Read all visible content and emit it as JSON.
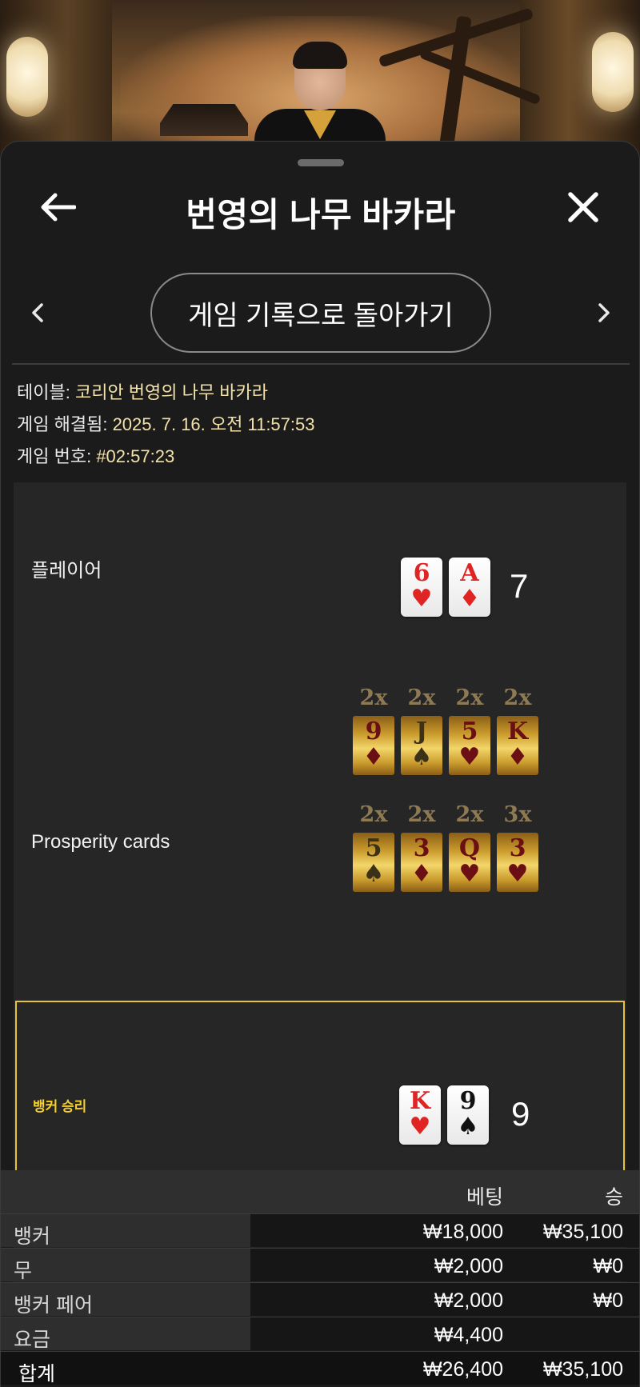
{
  "header": {
    "title": "번영의 나무 바카라",
    "back_icon": "arrow-left-icon",
    "close_icon": "close-icon"
  },
  "nav": {
    "back_to_history_label": "게임 기록으로 돌아가기",
    "prev_icon": "chevron-left-icon",
    "next_icon": "chevron-right-icon"
  },
  "info": {
    "table_label": "테이블:",
    "table_value": "코리안 번영의 나무 바카라",
    "resolved_label": "게임 해결됨:",
    "resolved_value": "2025. 7. 16. 오전 11:57:53",
    "game_no_label": "게임 번호:",
    "game_no_value": "#02:57:23"
  },
  "player": {
    "label": "플레이어",
    "cards": [
      {
        "rank": "6",
        "suit": "♥",
        "color": "red"
      },
      {
        "rank": "A",
        "suit": "♦",
        "color": "red"
      }
    ],
    "score": "7"
  },
  "prosperity": {
    "label": "Prosperity cards",
    "row1": [
      {
        "mult": "2x",
        "rank": "9",
        "suit": "♦",
        "tone": "red"
      },
      {
        "mult": "2x",
        "rank": "J",
        "suit": "♠",
        "tone": "dark"
      },
      {
        "mult": "2x",
        "rank": "5",
        "suit": "♥",
        "tone": "red"
      },
      {
        "mult": "2x",
        "rank": "K",
        "suit": "♦",
        "tone": "red"
      }
    ],
    "row2": [
      {
        "mult": "2x",
        "rank": "5",
        "suit": "♠",
        "tone": "dark"
      },
      {
        "mult": "2x",
        "rank": "3",
        "suit": "♦",
        "tone": "red"
      },
      {
        "mult": "2x",
        "rank": "Q",
        "suit": "♥",
        "tone": "red"
      },
      {
        "mult": "3x",
        "rank": "3",
        "suit": "♥",
        "tone": "red"
      }
    ]
  },
  "banker": {
    "label": "뱅커 승리",
    "cards": [
      {
        "rank": "K",
        "suit": "♥",
        "color": "red"
      },
      {
        "rank": "9",
        "suit": "♠",
        "color": "black"
      }
    ],
    "score": "9"
  },
  "bets": {
    "col_bet": "베팅",
    "col_win": "승",
    "rows": [
      {
        "name": "뱅커",
        "bet": "₩18,000",
        "win": "₩35,100"
      },
      {
        "name": "무",
        "bet": "₩2,000",
        "win": "₩0"
      },
      {
        "name": "뱅커 페어",
        "bet": "₩2,000",
        "win": "₩0"
      },
      {
        "name": "요금",
        "bet": "₩4,400",
        "win": ""
      }
    ],
    "total": {
      "name": "합계",
      "bet": "₩26,400",
      "win": "₩35,100"
    }
  },
  "colors": {
    "accent_gold": "#e5c43a",
    "value_text": "#f4e2a8",
    "card_red": "#e02424"
  }
}
